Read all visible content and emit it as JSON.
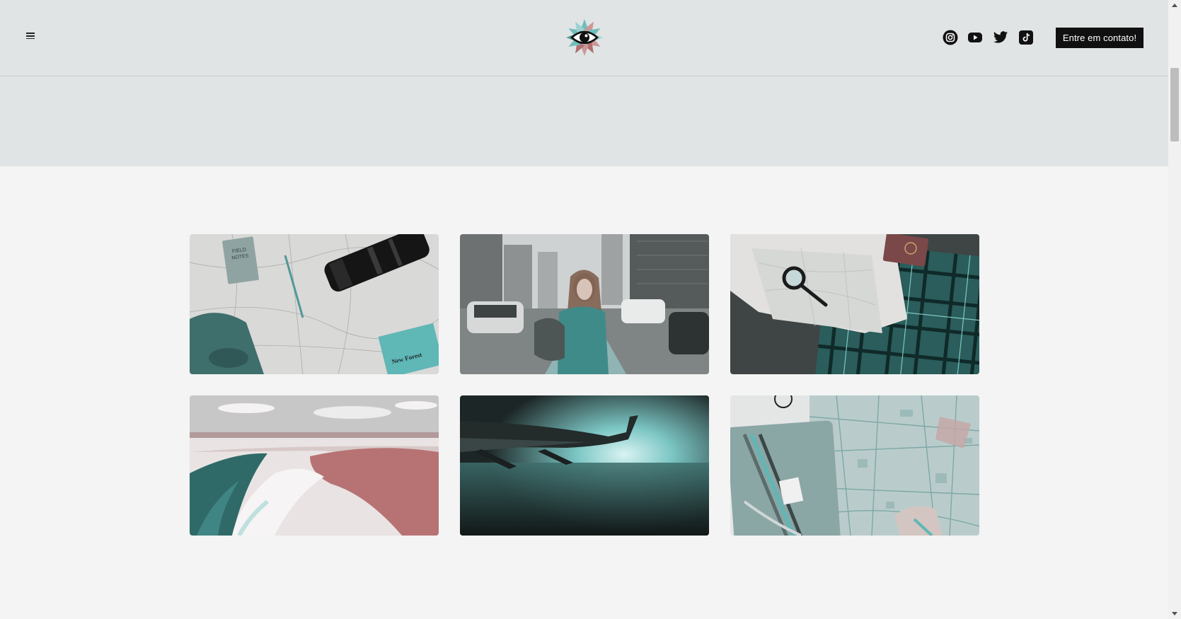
{
  "header": {
    "menu_icon": "hamburger-menu-icon",
    "logo_icon": "eye-flower-logo",
    "social": [
      {
        "name": "Instagram",
        "icon": "instagram-icon"
      },
      {
        "name": "YouTube",
        "icon": "youtube-icon"
      },
      {
        "name": "Twitter",
        "icon": "twitter-icon"
      },
      {
        "name": "TikTok",
        "icon": "tiktok-icon"
      }
    ],
    "cta_label": "Entre em contato!"
  },
  "gallery": {
    "images": [
      {
        "subject": "map-camera-backpack-photo",
        "printed_text": [
          "FIELD NOTES",
          "New Forest"
        ]
      },
      {
        "subject": "woman-city-street-photo",
        "printed_text": []
      },
      {
        "subject": "map-magnifier-suitcase-photo",
        "printed_text": []
      },
      {
        "subject": "beach-lagoon-aerial-photo",
        "printed_text": []
      },
      {
        "subject": "airplane-wing-photo",
        "printed_text": []
      },
      {
        "subject": "city-map-pencils-photo",
        "printed_text": []
      }
    ]
  },
  "colors": {
    "header_bg": "#e0e4e4",
    "page_bg": "#f3f4f3",
    "cta_bg": "#101010",
    "accent_teal": "#5fb7b6",
    "accent_rose": "#c98a8a"
  }
}
